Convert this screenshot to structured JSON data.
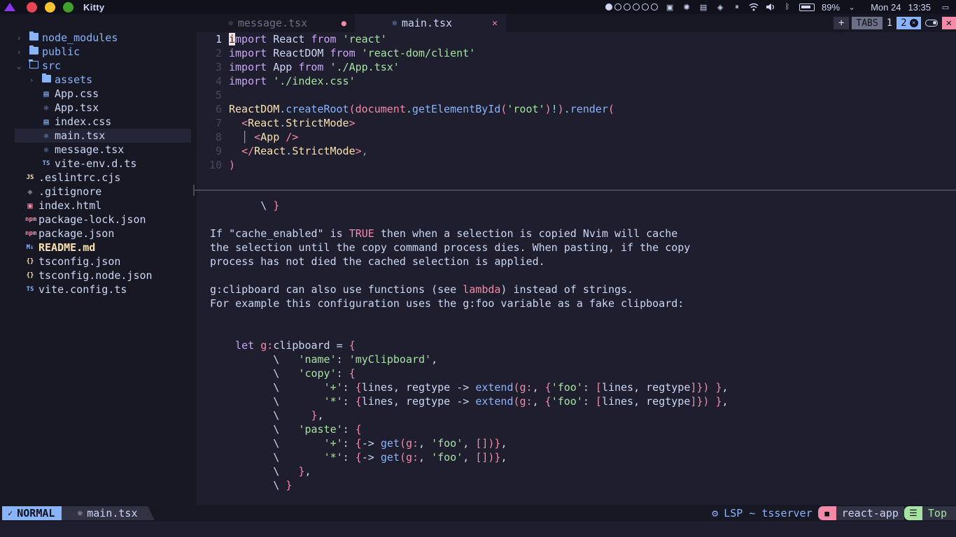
{
  "window": {
    "title": "Kitty"
  },
  "system": {
    "battery": "89%",
    "date": "Mon 24",
    "time": "13:35",
    "battery_level": 0.89
  },
  "tree": {
    "items": [
      {
        "label": "node_modules",
        "kind": "folder",
        "depth": 0,
        "expanded": false
      },
      {
        "label": "public",
        "kind": "folder",
        "depth": 0,
        "expanded": false
      },
      {
        "label": "src",
        "kind": "folder",
        "depth": 0,
        "expanded": true
      },
      {
        "label": "assets",
        "kind": "folder",
        "depth": 1,
        "expanded": false
      },
      {
        "label": "App.css",
        "kind": "css",
        "depth": 1
      },
      {
        "label": "App.tsx",
        "kind": "react",
        "depth": 1
      },
      {
        "label": "index.css",
        "kind": "css",
        "depth": 1
      },
      {
        "label": "main.tsx",
        "kind": "react",
        "depth": 1,
        "selected": true
      },
      {
        "label": "message.tsx",
        "kind": "react",
        "depth": 1
      },
      {
        "label": "vite-env.d.ts",
        "kind": "ts",
        "depth": 1
      },
      {
        "label": ".eslintrc.cjs",
        "kind": "js",
        "depth": 0
      },
      {
        "label": ".gitignore",
        "kind": "git",
        "depth": 0
      },
      {
        "label": "index.html",
        "kind": "html",
        "depth": 0
      },
      {
        "label": "package-lock.json",
        "kind": "npm",
        "depth": 0
      },
      {
        "label": "package.json",
        "kind": "npm",
        "depth": 0
      },
      {
        "label": "README.md",
        "kind": "md",
        "depth": 0,
        "modified": true
      },
      {
        "label": "tsconfig.json",
        "kind": "json",
        "depth": 0
      },
      {
        "label": "tsconfig.node.json",
        "kind": "json",
        "depth": 0
      },
      {
        "label": "vite.config.ts",
        "kind": "ts",
        "depth": 0
      }
    ]
  },
  "tabs": [
    {
      "label": "message.tsx",
      "active": false,
      "modified_marker": "●"
    },
    {
      "label": "main.tsx",
      "active": true,
      "close": "✕"
    }
  ],
  "tab_controls": {
    "add": "+",
    "label": "TABS",
    "tab1": "1",
    "tab2": "2"
  },
  "editor": {
    "lines": [
      [
        [
          "import",
          "kw"
        ],
        [
          " React ",
          ""
        ],
        [
          "from",
          "kw"
        ],
        [
          " ",
          ""
        ],
        [
          "'react'",
          "str"
        ]
      ],
      [
        [
          "import",
          "kw"
        ],
        [
          " ReactDOM ",
          ""
        ],
        [
          "from",
          "kw"
        ],
        [
          " ",
          ""
        ],
        [
          "'react-dom/client'",
          "str"
        ]
      ],
      [
        [
          "import",
          "kw"
        ],
        [
          " App ",
          ""
        ],
        [
          "from",
          "kw"
        ],
        [
          " ",
          ""
        ],
        [
          "'./App.tsx'",
          "str"
        ]
      ],
      [
        [
          "import",
          "kw"
        ],
        [
          " ",
          ""
        ],
        [
          "'./index.css'",
          "str"
        ]
      ],
      [],
      [
        [
          "ReactDOM",
          "comp"
        ],
        [
          ".",
          "op"
        ],
        [
          "createRoot",
          "fn"
        ],
        [
          "(",
          "par"
        ],
        [
          "document",
          "tag"
        ],
        [
          ".",
          "op"
        ],
        [
          "getElementById",
          "fn"
        ],
        [
          "(",
          "par"
        ],
        [
          "'root'",
          "str"
        ],
        [
          ")",
          "par"
        ],
        [
          "!",
          "op"
        ],
        [
          ")",
          "par"
        ],
        [
          ".",
          "op"
        ],
        [
          "render",
          "fn"
        ],
        [
          "(",
          "par"
        ]
      ],
      [
        [
          "  ",
          ""
        ],
        [
          "<",
          "tag"
        ],
        [
          "React",
          "comp"
        ],
        [
          ".",
          "op"
        ],
        [
          "StrictMode",
          "comp"
        ],
        [
          ">",
          "tag"
        ]
      ],
      [
        [
          "  ",
          ""
        ],
        [
          "│ ",
          "pun"
        ],
        [
          "<",
          "tag"
        ],
        [
          "App",
          "comp"
        ],
        [
          " />",
          "tag"
        ]
      ],
      [
        [
          "  ",
          ""
        ],
        [
          "</",
          "tag"
        ],
        [
          "React",
          "comp"
        ],
        [
          ".",
          "op"
        ],
        [
          "StrictMode",
          "comp"
        ],
        [
          ">",
          "tag"
        ],
        [
          ",",
          "pun"
        ]
      ],
      [
        [
          ")",
          "par"
        ]
      ]
    ]
  },
  "help": {
    "lines": [
      [
        [
          "        \\ ",
          ""
        ],
        [
          "}",
          "par"
        ]
      ],
      [],
      [
        [
          "If \"cache_enabled\" is ",
          ""
        ],
        [
          "TRUE",
          "tag"
        ],
        [
          " then when a selection is copied Nvim will cache",
          ""
        ]
      ],
      [
        [
          "the selection until the copy command process dies. When pasting, if the copy",
          ""
        ]
      ],
      [
        [
          "process has not died the cached selection is applied.",
          ""
        ]
      ],
      [],
      [
        [
          "g:clipboard can also use functions (see ",
          ""
        ],
        [
          "lambda",
          "lnk"
        ],
        [
          ") instead of strings.",
          ""
        ]
      ],
      [
        [
          "For example this configuration uses the g:foo variable as a fake clipboard:",
          ""
        ]
      ],
      [],
      [],
      [
        [
          "    ",
          ""
        ],
        [
          "let",
          "kw"
        ],
        [
          " ",
          ""
        ],
        [
          "g:",
          "tag"
        ],
        [
          "clipboard = ",
          ""
        ],
        [
          "{",
          "par"
        ]
      ],
      [
        [
          "          \\   ",
          ""
        ],
        [
          "'name'",
          "str"
        ],
        [
          ": ",
          ""
        ],
        [
          "'myClipboard'",
          "str"
        ],
        [
          ",",
          ""
        ]
      ],
      [
        [
          "          \\   ",
          ""
        ],
        [
          "'copy'",
          "str"
        ],
        [
          ": ",
          ""
        ],
        [
          "{",
          "par"
        ]
      ],
      [
        [
          "          \\       ",
          ""
        ],
        [
          "'+'",
          "str"
        ],
        [
          ": ",
          ""
        ],
        [
          "{",
          "par"
        ],
        [
          "lines, regtype -> ",
          ""
        ],
        [
          "extend",
          "fn"
        ],
        [
          "(",
          "par"
        ],
        [
          "g:",
          "tag"
        ],
        [
          ", ",
          ""
        ],
        [
          "{",
          "par"
        ],
        [
          "'foo'",
          "str"
        ],
        [
          ": ",
          ""
        ],
        [
          "[",
          "par"
        ],
        [
          "lines, regtype",
          ""
        ],
        [
          "]",
          "par"
        ],
        [
          "})",
          "par"
        ],
        [
          " ",
          ""
        ],
        [
          "}",
          "par"
        ],
        [
          ",",
          ""
        ]
      ],
      [
        [
          "          \\       ",
          ""
        ],
        [
          "'*'",
          "str"
        ],
        [
          ": ",
          ""
        ],
        [
          "{",
          "par"
        ],
        [
          "lines, regtype -> ",
          ""
        ],
        [
          "extend",
          "fn"
        ],
        [
          "(",
          "par"
        ],
        [
          "g:",
          "tag"
        ],
        [
          ", ",
          ""
        ],
        [
          "{",
          "par"
        ],
        [
          "'foo'",
          "str"
        ],
        [
          ": ",
          ""
        ],
        [
          "[",
          "par"
        ],
        [
          "lines, regtype",
          ""
        ],
        [
          "]",
          "par"
        ],
        [
          "})",
          "par"
        ],
        [
          " ",
          ""
        ],
        [
          "}",
          "par"
        ],
        [
          ",",
          ""
        ]
      ],
      [
        [
          "          \\     ",
          ""
        ],
        [
          "}",
          "par"
        ],
        [
          ",",
          ""
        ]
      ],
      [
        [
          "          \\   ",
          ""
        ],
        [
          "'paste'",
          "str"
        ],
        [
          ": ",
          ""
        ],
        [
          "{",
          "par"
        ]
      ],
      [
        [
          "          \\       ",
          ""
        ],
        [
          "'+'",
          "str"
        ],
        [
          ": ",
          ""
        ],
        [
          "{",
          "par"
        ],
        [
          "-> ",
          ""
        ],
        [
          "get",
          "fn"
        ],
        [
          "(",
          "par"
        ],
        [
          "g:",
          "tag"
        ],
        [
          ", ",
          ""
        ],
        [
          "'foo'",
          "str"
        ],
        [
          ", ",
          ""
        ],
        [
          "[]",
          "par"
        ],
        [
          ")}",
          "par"
        ],
        [
          ",",
          ""
        ]
      ],
      [
        [
          "          \\       ",
          ""
        ],
        [
          "'*'",
          "str"
        ],
        [
          ": ",
          ""
        ],
        [
          "{",
          "par"
        ],
        [
          "-> ",
          ""
        ],
        [
          "get",
          "fn"
        ],
        [
          "(",
          "par"
        ],
        [
          "g:",
          "tag"
        ],
        [
          ", ",
          ""
        ],
        [
          "'foo'",
          "str"
        ],
        [
          ", ",
          ""
        ],
        [
          "[]",
          "par"
        ],
        [
          ")}",
          "par"
        ],
        [
          ",",
          ""
        ]
      ],
      [
        [
          "          \\   ",
          ""
        ],
        [
          "}",
          "par"
        ],
        [
          ",",
          ""
        ]
      ],
      [
        [
          "          \\ ",
          ""
        ],
        [
          "}",
          "par"
        ]
      ]
    ]
  },
  "status": {
    "mode": "NORMAL",
    "file": "main.tsx",
    "lsp": "LSP ~ tsserver",
    "project": "react-app",
    "position": "Top"
  },
  "colors": {
    "accent_blue": "#89b4fa",
    "pink": "#f38ba8",
    "green": "#a6e3a1",
    "yellow": "#f9e2af",
    "background": "#1e1e2e"
  }
}
